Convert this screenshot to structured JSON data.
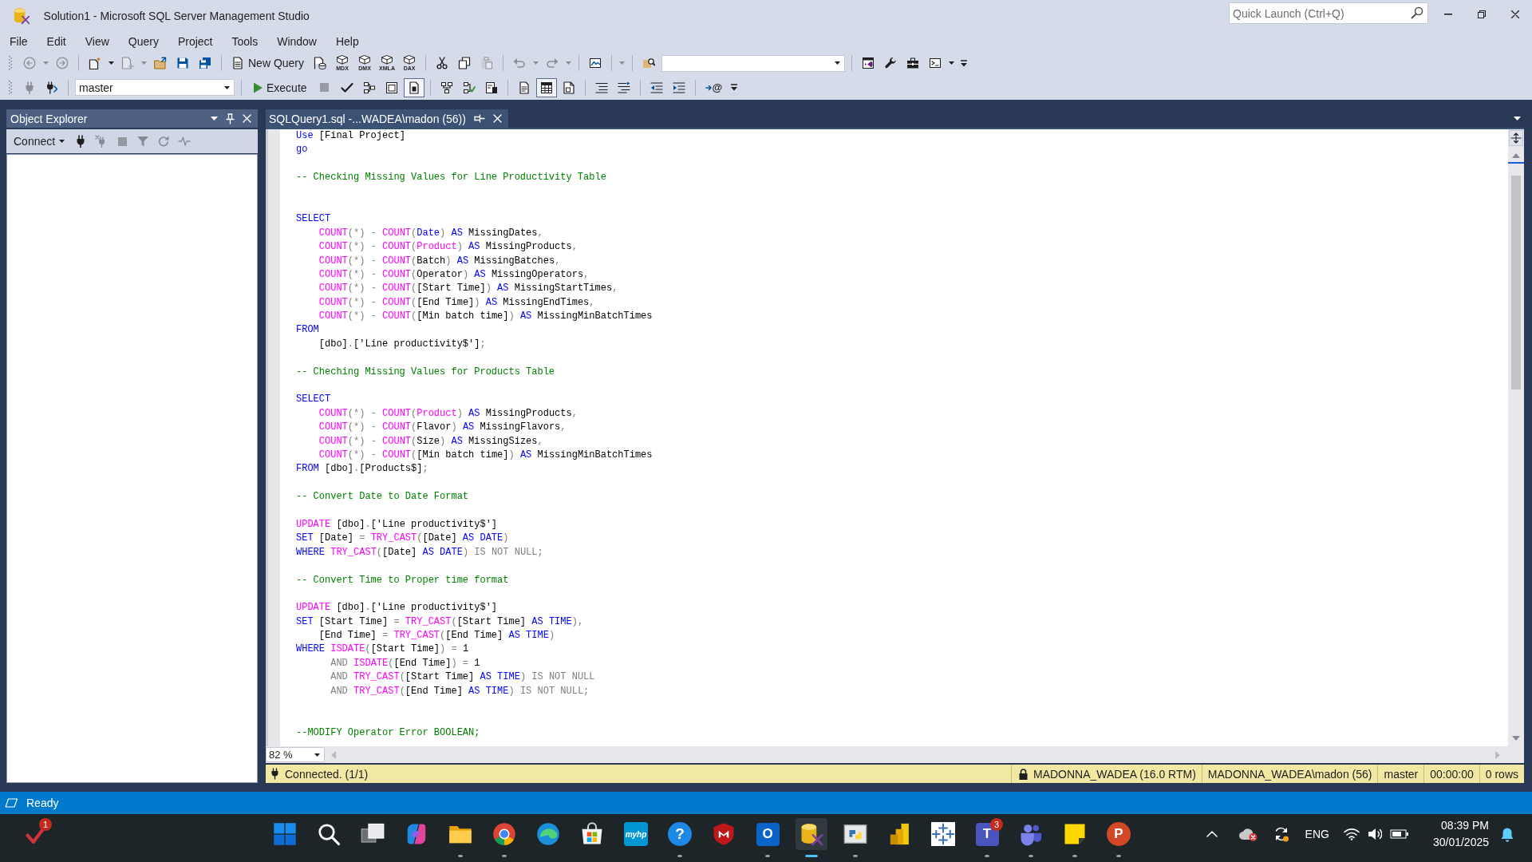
{
  "window": {
    "title": "Solution1 - Microsoft SQL Server Management Studio",
    "quick_launch": {
      "placeholder": "Quick Launch (Ctrl+Q)"
    }
  },
  "menu": [
    "File",
    "Edit",
    "View",
    "Query",
    "Project",
    "Tools",
    "Window",
    "Help"
  ],
  "toolbar_1": {
    "groups": [
      {
        "buttons": [
          {
            "kind": "back",
            "disabled": true
          },
          {
            "kind": "caret",
            "disabled": true
          },
          {
            "kind": "forward",
            "disabled": true
          }
        ]
      },
      {
        "buttons": [
          {
            "kind": "newproject",
            "disabled": false
          },
          {
            "kind": "caret",
            "disabled": false
          },
          {
            "kind": "additem",
            "disabled": true
          },
          {
            "kind": "caret",
            "disabled": true
          },
          {
            "kind": "open",
            "disabled": false
          },
          {
            "kind": "save",
            "disabled": false
          },
          {
            "kind": "saveall",
            "disabled": false
          }
        ]
      },
      {
        "buttons": [
          {
            "kind": "newquery",
            "label": "New Query",
            "disabled": false
          },
          {
            "kind": "dbquery",
            "disabled": false
          },
          {
            "kind": "cube",
            "label": "MDX",
            "disabled": false
          },
          {
            "kind": "cube",
            "label": "DMX",
            "disabled": false
          },
          {
            "kind": "cube",
            "label": "XMLA",
            "disabled": false
          },
          {
            "kind": "cube",
            "label": "DAX",
            "disabled": false
          }
        ]
      },
      {
        "buttons": [
          {
            "kind": "cut",
            "disabled": false
          },
          {
            "kind": "copy",
            "disabled": false
          },
          {
            "kind": "paste",
            "disabled": true
          }
        ]
      },
      {
        "buttons": [
          {
            "kind": "undo",
            "disabled": true
          },
          {
            "kind": "caret",
            "disabled": true
          },
          {
            "kind": "redo",
            "disabled": true
          },
          {
            "kind": "caret",
            "disabled": true
          }
        ]
      },
      {
        "buttons": [
          {
            "kind": "monitor",
            "disabled": false
          }
        ]
      },
      {
        "buttons": [
          {
            "kind": "caret",
            "disabled": true
          }
        ]
      },
      {
        "buttons": [
          {
            "kind": "findfolder",
            "disabled": false
          },
          {
            "kind": "combo",
            "disabled": false
          }
        ]
      },
      {
        "buttons": [
          {
            "kind": "vs",
            "disabled": false
          },
          {
            "kind": "wrench",
            "disabled": false
          },
          {
            "kind": "toolbox",
            "disabled": false
          },
          {
            "kind": "console",
            "disabled": false
          },
          {
            "kind": "caret",
            "disabled": false
          },
          {
            "kind": "overflow",
            "disabled": false
          }
        ]
      }
    ]
  },
  "toolbar_2": {
    "groups": [
      {
        "buttons": [
          {
            "kind": "plug",
            "disabled": true
          },
          {
            "kind": "swap",
            "disabled": false
          }
        ]
      },
      {
        "buttons": [
          {
            "kind": "combo",
            "value": "master",
            "disabled": false
          }
        ]
      },
      {
        "buttons": [
          {
            "kind": "execute",
            "label": "Execute",
            "disabled": false,
            "selected": false
          },
          {
            "kind": "stop",
            "disabled": true,
            "selected": false
          },
          {
            "kind": "check",
            "disabled": false,
            "selected": false
          },
          {
            "kind": "plan",
            "disabled": false,
            "selected": false
          },
          {
            "kind": "window",
            "disabled": false,
            "selected": false
          },
          {
            "kind": "doc",
            "disabled": false,
            "selected": true
          }
        ]
      },
      {
        "buttons": [
          {
            "kind": "plan2",
            "disabled": false
          },
          {
            "kind": "flowcheck",
            "disabled": false
          },
          {
            "kind": "stats",
            "disabled": false
          }
        ]
      },
      {
        "buttons": [
          {
            "kind": "text",
            "disabled": false,
            "selected": false
          },
          {
            "kind": "grid",
            "disabled": false,
            "selected": true
          },
          {
            "kind": "file",
            "disabled": false,
            "selected": false
          }
        ]
      },
      {
        "buttons": [
          {
            "kind": "comment",
            "disabled": false
          },
          {
            "kind": "uncomment",
            "disabled": false
          }
        ]
      },
      {
        "buttons": [
          {
            "kind": "outdent",
            "disabled": false
          },
          {
            "kind": "indent",
            "disabled": false
          }
        ]
      },
      {
        "buttons": [
          {
            "kind": "param",
            "label": "@",
            "disabled": false
          },
          {
            "kind": "overflow",
            "disabled": false
          }
        ]
      }
    ]
  },
  "object_explorer": {
    "title": "Object Explorer",
    "toolbar": [
      {
        "kind": "connect",
        "label": "Connect",
        "disabled": false
      },
      {
        "kind": "plug",
        "disabled": false
      },
      {
        "kind": "unplug",
        "disabled": true
      },
      {
        "kind": "stop",
        "disabled": true
      },
      {
        "kind": "filter",
        "disabled": true
      },
      {
        "kind": "refresh",
        "disabled": true
      },
      {
        "kind": "pulse",
        "disabled": true
      }
    ]
  },
  "editor": {
    "tabs": [
      {
        "title": "SQLQuery1.sql -...WADEA\\madon (56))",
        "selected": true
      }
    ],
    "lines": [
      {
        "kind": "code",
        "tokens": [
          {
            "kind": "keyword",
            "text": "Use"
          },
          {
            "kind": "plain",
            "text": " [Final Project]"
          }
        ]
      },
      {
        "kind": "code",
        "tokens": [
          {
            "kind": "keyword",
            "text": "go"
          }
        ]
      },
      {
        "kind": "blank"
      },
      {
        "kind": "code",
        "tokens": [
          {
            "kind": "comment",
            "text": "-- Checking Missing Values for Line Productivity Table"
          }
        ]
      },
      {
        "kind": "blank"
      },
      {
        "kind": "blank"
      },
      {
        "kind": "code",
        "tokens": [
          {
            "kind": "keyword",
            "text": "SELECT"
          }
        ]
      },
      {
        "kind": "code",
        "tokens": [
          {
            "kind": "function",
            "text": "    COUNT"
          },
          {
            "kind": "operator",
            "text": "(*) - "
          },
          {
            "kind": "function",
            "text": "COUNT"
          },
          {
            "kind": "operator",
            "text": "("
          },
          {
            "kind": "keyword",
            "text": "Date"
          },
          {
            "kind": "operator",
            "text": ") "
          },
          {
            "kind": "keyword",
            "text": "AS"
          },
          {
            "kind": "plain",
            "text": " MissingDates"
          },
          {
            "kind": "operator",
            "text": ","
          }
        ]
      },
      {
        "kind": "code",
        "tokens": [
          {
            "kind": "function",
            "text": "    COUNT"
          },
          {
            "kind": "operator",
            "text": "(*) - "
          },
          {
            "kind": "function",
            "text": "COUNT"
          },
          {
            "kind": "operator",
            "text": "("
          },
          {
            "kind": "function",
            "text": "Product"
          },
          {
            "kind": "operator",
            "text": ") "
          },
          {
            "kind": "keyword",
            "text": "AS"
          },
          {
            "kind": "plain",
            "text": " MissingProducts"
          },
          {
            "kind": "operator",
            "text": ","
          }
        ]
      },
      {
        "kind": "code",
        "tokens": [
          {
            "kind": "function",
            "text": "    COUNT"
          },
          {
            "kind": "operator",
            "text": "(*) - "
          },
          {
            "kind": "function",
            "text": "COUNT"
          },
          {
            "kind": "operator",
            "text": "("
          },
          {
            "kind": "plain",
            "text": "Batch"
          },
          {
            "kind": "operator",
            "text": ") "
          },
          {
            "kind": "keyword",
            "text": "AS"
          },
          {
            "kind": "plain",
            "text": " MissingBatches"
          },
          {
            "kind": "operator",
            "text": ","
          }
        ]
      },
      {
        "kind": "code",
        "tokens": [
          {
            "kind": "function",
            "text": "    COUNT"
          },
          {
            "kind": "operator",
            "text": "(*) - "
          },
          {
            "kind": "function",
            "text": "COUNT"
          },
          {
            "kind": "operator",
            "text": "("
          },
          {
            "kind": "plain",
            "text": "Operator"
          },
          {
            "kind": "operator",
            "text": ") "
          },
          {
            "kind": "keyword",
            "text": "AS"
          },
          {
            "kind": "plain",
            "text": " MissingOperators"
          },
          {
            "kind": "operator",
            "text": ","
          }
        ]
      },
      {
        "kind": "code",
        "tokens": [
          {
            "kind": "function",
            "text": "    COUNT"
          },
          {
            "kind": "operator",
            "text": "(*) - "
          },
          {
            "kind": "function",
            "text": "COUNT"
          },
          {
            "kind": "operator",
            "text": "("
          },
          {
            "kind": "plain",
            "text": "[Start Time]"
          },
          {
            "kind": "operator",
            "text": ") "
          },
          {
            "kind": "keyword",
            "text": "AS"
          },
          {
            "kind": "plain",
            "text": " MissingStartTimes"
          },
          {
            "kind": "operator",
            "text": ","
          }
        ]
      },
      {
        "kind": "code",
        "tokens": [
          {
            "kind": "function",
            "text": "    COUNT"
          },
          {
            "kind": "operator",
            "text": "(*) - "
          },
          {
            "kind": "function",
            "text": "COUNT"
          },
          {
            "kind": "operator",
            "text": "("
          },
          {
            "kind": "plain",
            "text": "[End Time]"
          },
          {
            "kind": "operator",
            "text": ") "
          },
          {
            "kind": "keyword",
            "text": "AS"
          },
          {
            "kind": "plain",
            "text": " MissingEndTimes"
          },
          {
            "kind": "operator",
            "text": ","
          }
        ]
      },
      {
        "kind": "code",
        "tokens": [
          {
            "kind": "function",
            "text": "    COUNT"
          },
          {
            "kind": "operator",
            "text": "(*) - "
          },
          {
            "kind": "function",
            "text": "COUNT"
          },
          {
            "kind": "operator",
            "text": "("
          },
          {
            "kind": "plain",
            "text": "[Min batch time]"
          },
          {
            "kind": "operator",
            "text": ") "
          },
          {
            "kind": "keyword",
            "text": "AS"
          },
          {
            "kind": "plain",
            "text": " MissingMinBatchTimes"
          }
        ]
      },
      {
        "kind": "code",
        "tokens": [
          {
            "kind": "keyword",
            "text": "FROM"
          }
        ]
      },
      {
        "kind": "code",
        "tokens": [
          {
            "kind": "plain",
            "text": "    [dbo]"
          },
          {
            "kind": "operator",
            "text": "."
          },
          {
            "kind": "plain",
            "text": "['Line productivity$']"
          },
          {
            "kind": "operator",
            "text": ";"
          }
        ]
      },
      {
        "kind": "blank"
      },
      {
        "kind": "code",
        "tokens": [
          {
            "kind": "comment",
            "text": "-- Cheching Missing Values for Products Table"
          }
        ]
      },
      {
        "kind": "blank"
      },
      {
        "kind": "code",
        "tokens": [
          {
            "kind": "keyword",
            "text": "SELECT"
          }
        ]
      },
      {
        "kind": "code",
        "tokens": [
          {
            "kind": "function",
            "text": "    COUNT"
          },
          {
            "kind": "operator",
            "text": "(*) - "
          },
          {
            "kind": "function",
            "text": "COUNT"
          },
          {
            "kind": "operator",
            "text": "("
          },
          {
            "kind": "function",
            "text": "Product"
          },
          {
            "kind": "operator",
            "text": ") "
          },
          {
            "kind": "keyword",
            "text": "AS"
          },
          {
            "kind": "plain",
            "text": " MissingProducts"
          },
          {
            "kind": "operator",
            "text": ","
          }
        ]
      },
      {
        "kind": "code",
        "tokens": [
          {
            "kind": "function",
            "text": "    COUNT"
          },
          {
            "kind": "operator",
            "text": "(*) - "
          },
          {
            "kind": "function",
            "text": "COUNT"
          },
          {
            "kind": "operator",
            "text": "("
          },
          {
            "kind": "plain",
            "text": "Flavor"
          },
          {
            "kind": "operator",
            "text": ") "
          },
          {
            "kind": "keyword",
            "text": "AS"
          },
          {
            "kind": "plain",
            "text": " MissingFlavors"
          },
          {
            "kind": "operator",
            "text": ","
          }
        ]
      },
      {
        "kind": "code",
        "tokens": [
          {
            "kind": "function",
            "text": "    COUNT"
          },
          {
            "kind": "operator",
            "text": "(*) - "
          },
          {
            "kind": "function",
            "text": "COUNT"
          },
          {
            "kind": "operator",
            "text": "("
          },
          {
            "kind": "plain",
            "text": "Size"
          },
          {
            "kind": "operator",
            "text": ") "
          },
          {
            "kind": "keyword",
            "text": "AS"
          },
          {
            "kind": "plain",
            "text": " MissingSizes"
          },
          {
            "kind": "operator",
            "text": ","
          }
        ]
      },
      {
        "kind": "code",
        "tokens": [
          {
            "kind": "function",
            "text": "    COUNT"
          },
          {
            "kind": "operator",
            "text": "(*) - "
          },
          {
            "kind": "function",
            "text": "COUNT"
          },
          {
            "kind": "operator",
            "text": "("
          },
          {
            "kind": "plain",
            "text": "[Min batch time]"
          },
          {
            "kind": "operator",
            "text": ") "
          },
          {
            "kind": "keyword",
            "text": "AS"
          },
          {
            "kind": "plain",
            "text": " MissingMinBatchTimes"
          }
        ]
      },
      {
        "kind": "code",
        "tokens": [
          {
            "kind": "keyword",
            "text": "FROM"
          },
          {
            "kind": "plain",
            "text": " [dbo]"
          },
          {
            "kind": "operator",
            "text": "."
          },
          {
            "kind": "plain",
            "text": "[Products$]"
          },
          {
            "kind": "operator",
            "text": ";"
          }
        ]
      },
      {
        "kind": "blank"
      },
      {
        "kind": "code",
        "tokens": [
          {
            "kind": "comment",
            "text": "-- Convert Date to Date Format"
          }
        ]
      },
      {
        "kind": "blank"
      },
      {
        "kind": "code",
        "tokens": [
          {
            "kind": "function",
            "text": "UPDATE"
          },
          {
            "kind": "plain",
            "text": " [dbo]"
          },
          {
            "kind": "operator",
            "text": "."
          },
          {
            "kind": "plain",
            "text": "['Line productivity$']"
          }
        ]
      },
      {
        "kind": "code",
        "tokens": [
          {
            "kind": "keyword",
            "text": "SET"
          },
          {
            "kind": "plain",
            "text": " [Date] "
          },
          {
            "kind": "operator",
            "text": "= "
          },
          {
            "kind": "function",
            "text": "TRY_CAST"
          },
          {
            "kind": "operator",
            "text": "("
          },
          {
            "kind": "plain",
            "text": "[Date] "
          },
          {
            "kind": "keyword",
            "text": "AS DATE"
          },
          {
            "kind": "operator",
            "text": ")"
          }
        ]
      },
      {
        "kind": "code",
        "tokens": [
          {
            "kind": "keyword",
            "text": "WHERE "
          },
          {
            "kind": "function",
            "text": "TRY_CAST"
          },
          {
            "kind": "operator",
            "text": "("
          },
          {
            "kind": "plain",
            "text": "[Date] "
          },
          {
            "kind": "keyword",
            "text": "AS DATE"
          },
          {
            "kind": "operator",
            "text": ") IS NOT NULL;"
          }
        ]
      },
      {
        "kind": "blank"
      },
      {
        "kind": "code",
        "tokens": [
          {
            "kind": "comment",
            "text": "-- Convert Time to Proper time format"
          }
        ]
      },
      {
        "kind": "blank"
      },
      {
        "kind": "code",
        "tokens": [
          {
            "kind": "function",
            "text": "UPDATE"
          },
          {
            "kind": "plain",
            "text": " [dbo]"
          },
          {
            "kind": "operator",
            "text": "."
          },
          {
            "kind": "plain",
            "text": "['Line productivity$']"
          }
        ]
      },
      {
        "kind": "code",
        "tokens": [
          {
            "kind": "keyword",
            "text": "SET"
          },
          {
            "kind": "plain",
            "text": " [Start Time] "
          },
          {
            "kind": "operator",
            "text": "= "
          },
          {
            "kind": "function",
            "text": "TRY_CAST"
          },
          {
            "kind": "operator",
            "text": "("
          },
          {
            "kind": "plain",
            "text": "[Start Time] "
          },
          {
            "kind": "keyword",
            "text": "AS TIME"
          },
          {
            "kind": "operator",
            "text": "),"
          }
        ]
      },
      {
        "kind": "code",
        "tokens": [
          {
            "kind": "plain",
            "text": "    [End Time] "
          },
          {
            "kind": "operator",
            "text": "= "
          },
          {
            "kind": "function",
            "text": "TRY_CAST"
          },
          {
            "kind": "operator",
            "text": "("
          },
          {
            "kind": "plain",
            "text": "[End Time] "
          },
          {
            "kind": "keyword",
            "text": "AS TIME"
          },
          {
            "kind": "operator",
            "text": ")"
          }
        ]
      },
      {
        "kind": "code",
        "tokens": [
          {
            "kind": "keyword",
            "text": "WHERE "
          },
          {
            "kind": "function",
            "text": "ISDATE"
          },
          {
            "kind": "operator",
            "text": "("
          },
          {
            "kind": "plain",
            "text": "[Start Time]"
          },
          {
            "kind": "operator",
            "text": ") = "
          },
          {
            "kind": "plain",
            "text": "1"
          }
        ]
      },
      {
        "kind": "code",
        "tokens": [
          {
            "kind": "operator",
            "text": "      AND "
          },
          {
            "kind": "function",
            "text": "ISDATE"
          },
          {
            "kind": "operator",
            "text": "("
          },
          {
            "kind": "plain",
            "text": "[End Time]"
          },
          {
            "kind": "operator",
            "text": ") = "
          },
          {
            "kind": "plain",
            "text": "1"
          }
        ]
      },
      {
        "kind": "code",
        "tokens": [
          {
            "kind": "operator",
            "text": "      AND "
          },
          {
            "kind": "function",
            "text": "TRY_CAST"
          },
          {
            "kind": "operator",
            "text": "("
          },
          {
            "kind": "plain",
            "text": "[Start Time] "
          },
          {
            "kind": "keyword",
            "text": "AS TIME"
          },
          {
            "kind": "operator",
            "text": ") IS NOT NULL"
          }
        ]
      },
      {
        "kind": "code",
        "tokens": [
          {
            "kind": "operator",
            "text": "      AND "
          },
          {
            "kind": "function",
            "text": "TRY_CAST"
          },
          {
            "kind": "operator",
            "text": "("
          },
          {
            "kind": "plain",
            "text": "[End Time] "
          },
          {
            "kind": "keyword",
            "text": "AS TIME"
          },
          {
            "kind": "operator",
            "text": ") IS NOT NULL;"
          }
        ]
      },
      {
        "kind": "blank"
      },
      {
        "kind": "blank"
      },
      {
        "kind": "code",
        "tokens": [
          {
            "kind": "comment",
            "text": "--MODIFY Operator Error BOOLEAN;"
          }
        ]
      }
    ],
    "zoom": "82 %"
  },
  "query_status": {
    "message": "Connected. (1/1)",
    "server": "MADONNA_WADEA (16.0 RTM)",
    "login": "MADONNA_WADEA\\madon (56)",
    "database": "master",
    "elapsed": "00:00:00",
    "rows": "0 rows"
  },
  "status_bar": {
    "text": "Ready"
  },
  "taskbar": {
    "corner_app": {
      "badge": "1"
    },
    "apps": [
      {
        "kind": "squares",
        "running": false,
        "selected": false
      },
      {
        "kind": "magnifier",
        "running": false,
        "selected": false
      },
      {
        "kind": "stack",
        "running": false,
        "selected": false
      },
      {
        "kind": "swirl",
        "running": false,
        "selected": false
      },
      {
        "kind": "folder",
        "running": true,
        "selected": false
      },
      {
        "kind": "ring",
        "running": true,
        "selected": false
      },
      {
        "kind": "wave",
        "running": false,
        "selected": false
      },
      {
        "kind": "bag",
        "running": false,
        "selected": false
      },
      {
        "kind": "tile",
        "label": "myhp",
        "running": false,
        "selected": false
      },
      {
        "kind": "help",
        "label": "?",
        "running": true,
        "selected": false
      },
      {
        "kind": "shield",
        "running": false,
        "selected": false
      },
      {
        "kind": "mail",
        "label": "O",
        "running": true,
        "selected": false
      },
      {
        "kind": "database",
        "running": true,
        "selected": true
      },
      {
        "kind": "snakes",
        "running": true,
        "selected": false
      },
      {
        "kind": "bars",
        "running": false,
        "selected": false
      },
      {
        "kind": "crosses",
        "running": false,
        "selected": false
      },
      {
        "kind": "chat",
        "label": "T",
        "badge": "3",
        "running": true,
        "selected": false
      },
      {
        "kind": "people",
        "running": true,
        "selected": false
      },
      {
        "kind": "note",
        "running": true,
        "selected": false
      },
      {
        "kind": "slides",
        "label": "P",
        "running": true,
        "selected": false
      }
    ],
    "tray": {
      "language": "ENG",
      "time": "08:39 PM",
      "date": "30/01/2025"
    }
  }
}
